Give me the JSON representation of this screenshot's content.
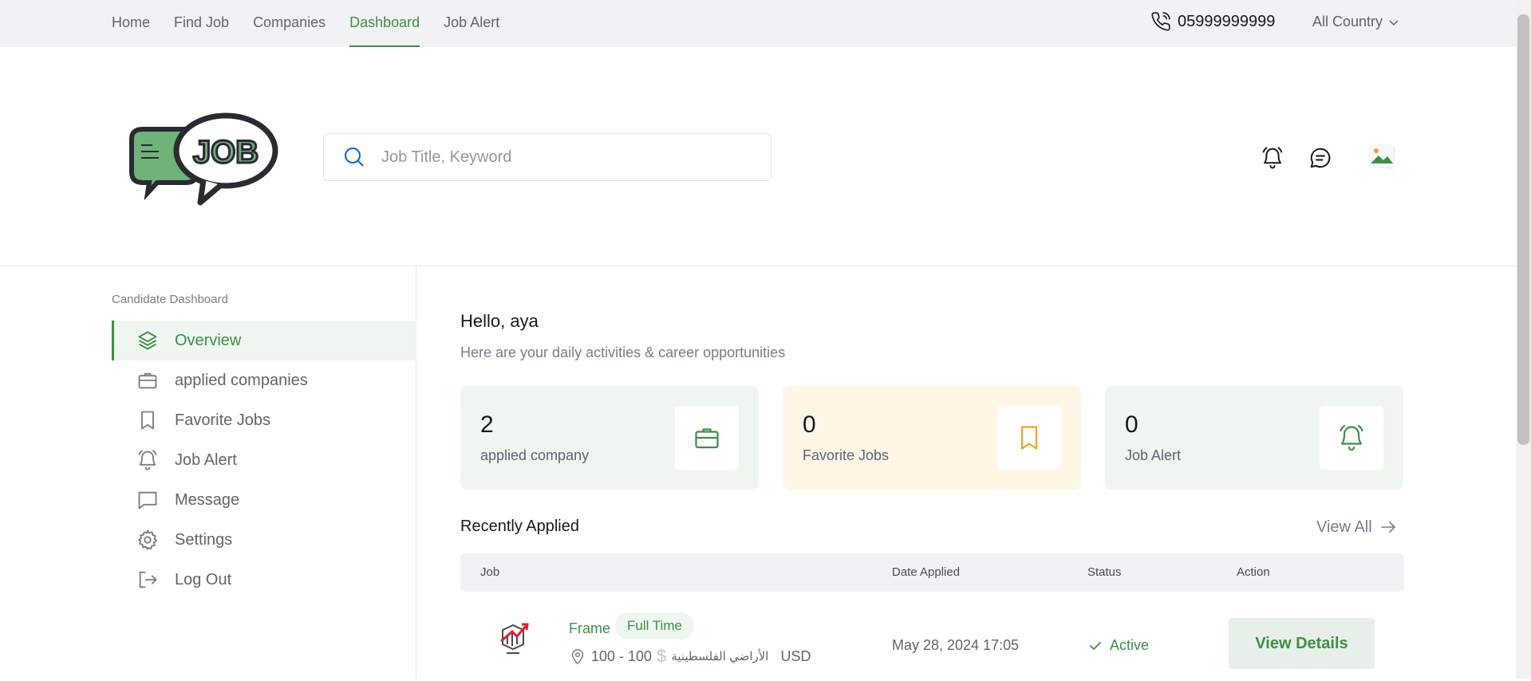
{
  "topnav": {
    "links": [
      "Home",
      "Find Job",
      "Companies",
      "Dashboard",
      "Job Alert"
    ],
    "active_index": 3,
    "phone": "05999999999",
    "country": "All Country"
  },
  "header": {
    "logo_text": "JOB",
    "search_placeholder": "Job Title, Keyword"
  },
  "sidebar": {
    "title": "Candidate Dashboard",
    "items": [
      {
        "label": "Overview",
        "icon": "layers-icon",
        "active": true
      },
      {
        "label": "applied companies",
        "icon": "briefcase-icon",
        "active": false
      },
      {
        "label": "Favorite Jobs",
        "icon": "bookmark-icon",
        "active": false
      },
      {
        "label": "Job Alert",
        "icon": "bell-icon",
        "active": false
      },
      {
        "label": "Message",
        "icon": "message-icon",
        "active": false
      },
      {
        "label": "Settings",
        "icon": "gear-icon",
        "active": false
      },
      {
        "label": "Log Out",
        "icon": "logout-icon",
        "active": false
      }
    ]
  },
  "main": {
    "greeting": "Hello, aya",
    "subtitle": "Here are your daily activities & career opportunities",
    "stats": [
      {
        "value": "2",
        "label": "applied company",
        "icon": "briefcase-icon",
        "color": "#3d8f45",
        "bg": "#eef6ef"
      },
      {
        "value": "0",
        "label": "Favorite Jobs",
        "icon": "bookmark-icon",
        "color": "#f0a422",
        "bg": "#fff6e6"
      },
      {
        "value": "0",
        "label": "Job Alert",
        "icon": "bell-icon",
        "color": "#3d8f45",
        "bg": "#eef6ef"
      }
    ],
    "recent_title": "Recently Applied",
    "view_all": "View All",
    "table": {
      "headers": [
        "Job",
        "Date Applied",
        "Status",
        "Action"
      ],
      "rows": [
        {
          "title": "Frame",
          "type": "Full Time",
          "salary": "100 - 100",
          "location": "الأراضي الفلسطينية",
          "currency": "USD",
          "date": "May 28, 2024 17:05",
          "status": "Active",
          "action": "View Details"
        }
      ]
    }
  },
  "colors": {
    "accent": "#3d8f45",
    "accent_bg": "#eef6ef",
    "warning": "#f0a422",
    "warning_bg": "#fff6e6",
    "topbar_bg": "#f1f2f4"
  }
}
